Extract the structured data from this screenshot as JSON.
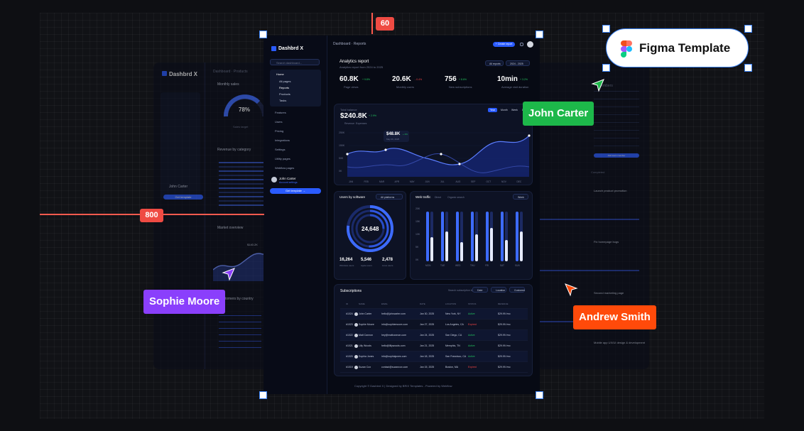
{
  "guides": {
    "top_value": "60",
    "left_value": "800"
  },
  "figma_pill": {
    "label": "Figma Template"
  },
  "cursors": {
    "john": {
      "name": "John Carter",
      "color": "#1db84a"
    },
    "sophie": {
      "name": "Sophie Moore",
      "color": "#8a3ffc"
    },
    "andrew": {
      "name": "Andrew Smith",
      "color": "#ff4a0a"
    }
  },
  "left_panel": {
    "brand": "Dashbrd X",
    "breadcrumb": "Dashboard · Products",
    "monthly_sales": "Monthly sales",
    "gauge_value": "78%",
    "sales_target": "Sales target",
    "revenue_by_category": "Revenue by category",
    "market_overview": "Market overview",
    "market_value": "$140.2K",
    "customers_by_country": "Customers by country",
    "kpi_value": "K",
    "user_name": "John Carter",
    "cta": "Get template"
  },
  "right_panel": {
    "members": "Members",
    "add_member": "Add team member",
    "completed": "Completed",
    "tasks": [
      "Launch product promotion",
      "Fix homepage bugs",
      "Second marketing page",
      "Mobile app UX/UI design & development"
    ]
  },
  "main": {
    "brand": "Dashbrd X",
    "breadcrumb": "Dashboard  ·  Reports",
    "create_report": "+ Create report",
    "search_placeholder": "Search dashboard...",
    "nav": {
      "home": "Home",
      "sub": [
        "All pages",
        "Reports",
        "Products",
        "Tasks"
      ],
      "items": [
        "Features",
        "Users",
        "Pricing",
        "Integrations",
        "Settings",
        "Utility pages",
        "Webflow pages"
      ]
    },
    "user": {
      "name": "John Carter",
      "sub": "Account settings"
    },
    "get_template": "Get template  →",
    "analytics": {
      "title": "Analytics report",
      "subtitle": "Analytics report from 2024 to 2025",
      "filter_reports": "All reports",
      "filter_date": "2024 - 2025",
      "kpis": [
        {
          "value": "60.8K",
          "delta": "+ 9.8%",
          "label": "Page views",
          "up": true
        },
        {
          "value": "20.6K",
          "delta": "- 0.4%",
          "label": "Monthly users",
          "up": false
        },
        {
          "value": "756",
          "delta": "+ 8.6%",
          "label": "New subscriptions",
          "up": true
        },
        {
          "value": "10min",
          "delta": "+ 3.2%",
          "label": "Average visit duration",
          "up": true
        }
      ]
    },
    "balance": {
      "label": "Total balance",
      "value": "$240.8K",
      "delta": "+ 2.9%",
      "legend": [
        "Revenue",
        "Expenses"
      ],
      "tabs": [
        "Year",
        "Month",
        "Week",
        "Day"
      ],
      "tooltip_value": "$48.8K",
      "tooltip_delta": "+ 2%",
      "tooltip_date": "May 06, 2025",
      "yticks": [
        "250K",
        "150K",
        "50K",
        "0K"
      ],
      "months": [
        "JAN",
        "FEB",
        "MAR",
        "APR",
        "MAY",
        "JUN",
        "JUL",
        "AUG",
        "SEP",
        "OCT",
        "NOV",
        "DEC"
      ]
    },
    "software": {
      "title": "Users by software",
      "filter": "All platforms",
      "total": "24,648",
      "stats": [
        {
          "value": "16,264",
          "label": "Windows users"
        },
        {
          "value": "5,546",
          "label": "Apple users"
        },
        {
          "value": "2,478",
          "label": "Linux users"
        }
      ]
    },
    "traffic": {
      "title": "Web traffic",
      "legend": [
        "Direct",
        "Organic search"
      ],
      "filter": "Week",
      "yticks": [
        "20K",
        "15K",
        "10K",
        "5K",
        "0K"
      ],
      "days": [
        "MON",
        "TUE",
        "WED",
        "THU",
        "FRI",
        "SAT",
        "SUN"
      ]
    },
    "subscriptions": {
      "title": "Subscriptions",
      "search_label": "Search subscription by",
      "filters": [
        "Date",
        "Location",
        "Customer"
      ],
      "headers": [
        "ID",
        "NAME",
        "EMAIL",
        "DATE",
        "LOCATION",
        "STATUS",
        "REVENUE"
      ],
      "rows": [
        [
          "#1024",
          "John Carter",
          "hello@johncarter.com",
          "Jan 30, 2025",
          "New York, NY",
          "Active",
          "$29.99 /mo"
        ],
        [
          "#1023",
          "Sophie Moore",
          "info@sophiemoore.com",
          "Jan 27, 2025",
          "Los Angeles, CA",
          "Expired",
          "$29.99 /mo"
        ],
        [
          "#1022",
          "Matt Cannon",
          "hey@mattcannon.com",
          "Jan 24, 2025",
          "San Diego, CA",
          "Active",
          "$29.99 /mo"
        ],
        [
          "#1021",
          "Lilly Woods",
          "hello@lillywoods.com",
          "Jan 21, 2025",
          "Memphis, TN",
          "Active",
          "$29.99 /mo"
        ],
        [
          "#1020",
          "Sophia Jones",
          "info@sophiajones.com",
          "Jan 18, 2025",
          "San Francisco, CA",
          "Active",
          "$29.99 /mo"
        ],
        [
          "#1019",
          "Suzan Cox",
          "contact@suzancox.com",
          "Jan 15, 2025",
          "Boston, MA",
          "Expired",
          "$29.99 /mo"
        ]
      ]
    },
    "footer": "Copyright © Dashbrd X | Designed by BRIX Templates - Powered by Webflow"
  }
}
